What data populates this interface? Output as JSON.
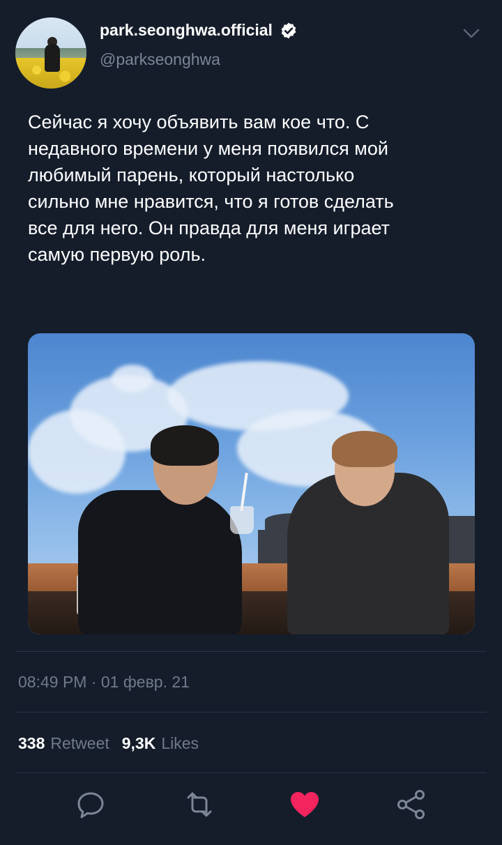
{
  "user": {
    "display_name": "park.seonghwa.official",
    "handle": "@parkseonghwa",
    "verified": true
  },
  "tweet": {
    "text": "Сейчас я хочу объявить вам кое что. С\nнедавного времени у меня появился мой\nлюбимый парень, который настолько\nсильно мне нравится, что я готов сделать\nвсе для него. Он правда для меня играет\nсамую первую роль.",
    "timestamp": "08:49 PM · 01 февр. 21"
  },
  "stats": {
    "retweet_count": "338",
    "retweet_label": "Retweet",
    "likes_count": "9,3K",
    "likes_label": "Likes"
  },
  "actions": {
    "icons": [
      "reply-icon",
      "retweet-icon",
      "like-icon",
      "share-icon"
    ],
    "liked": true
  },
  "colors": {
    "background": "#151d2b",
    "secondary_text": "#6e7a8b",
    "like": "#f4245e",
    "icon": "#7c8797"
  }
}
